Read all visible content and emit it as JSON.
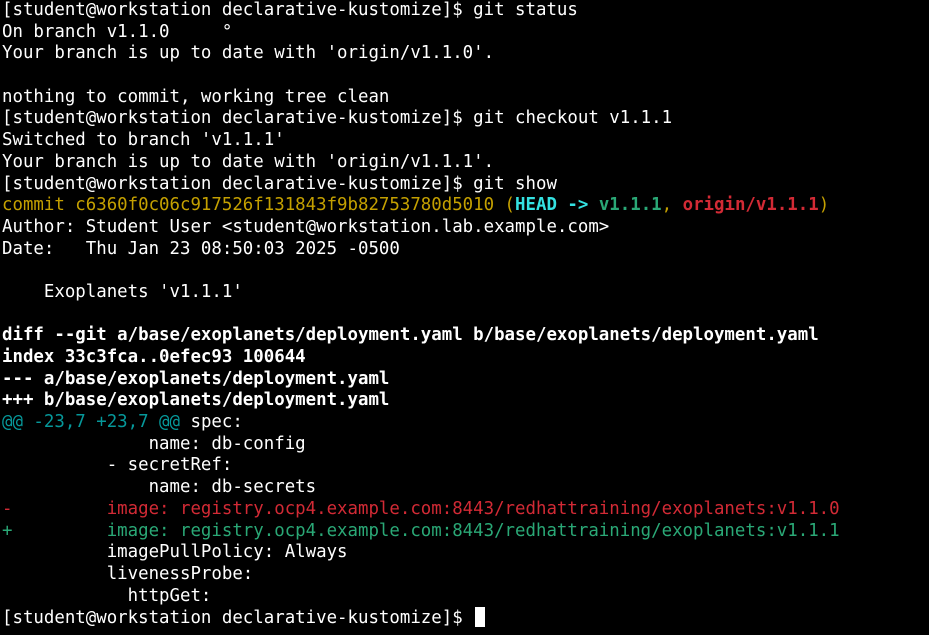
{
  "window": {
    "type": "terminal",
    "background": "#000000",
    "foreground": "#ffffff"
  },
  "lines": [
    {
      "segs": [
        {
          "t": "[student@workstation declarative-kustomize]$ git status",
          "c": "default"
        }
      ]
    },
    {
      "segs": [
        {
          "t": "On branch v1.1.0     °",
          "c": "default"
        }
      ]
    },
    {
      "segs": [
        {
          "t": "Your branch is up to date with 'origin/v1.1.0'.",
          "c": "default"
        }
      ]
    },
    {
      "segs": [
        {
          "t": "",
          "c": "default"
        }
      ]
    },
    {
      "segs": [
        {
          "t": "nothing to commit, working tree clean",
          "c": "default"
        }
      ]
    },
    {
      "segs": [
        {
          "t": "[student@workstation declarative-kustomize]$ git checkout v1.1.1",
          "c": "default"
        }
      ]
    },
    {
      "segs": [
        {
          "t": "Switched to branch 'v1.1.1'",
          "c": "default"
        }
      ]
    },
    {
      "segs": [
        {
          "t": "Your branch is up to date with 'origin/v1.1.1'.",
          "c": "default"
        }
      ]
    },
    {
      "segs": [
        {
          "t": "[student@workstation declarative-kustomize]$ git show",
          "c": "default"
        }
      ]
    },
    {
      "segs": [
        {
          "t": "commit c6360f0c06c917526f131843f9b82753780d5010 (",
          "c": "yellow"
        },
        {
          "t": "HEAD -> ",
          "c": "bcyan",
          "b": true
        },
        {
          "t": "v1.1.1",
          "c": "green",
          "b": true
        },
        {
          "t": ", ",
          "c": "yellow"
        },
        {
          "t": "origin/v1.1.1",
          "c": "red",
          "b": true
        },
        {
          "t": ")",
          "c": "yellow"
        }
      ]
    },
    {
      "segs": [
        {
          "t": "Author: Student User <student@workstation.lab.example.com>",
          "c": "default"
        }
      ]
    },
    {
      "segs": [
        {
          "t": "Date:   Thu Jan 23 08:50:03 2025 -0500",
          "c": "default"
        }
      ]
    },
    {
      "segs": [
        {
          "t": "",
          "c": "default"
        }
      ]
    },
    {
      "segs": [
        {
          "t": "    Exoplanets 'v1.1.1'",
          "c": "default"
        }
      ]
    },
    {
      "segs": [
        {
          "t": "",
          "c": "default"
        }
      ]
    },
    {
      "segs": [
        {
          "t": "diff --git a/base/exoplanets/deployment.yaml b/base/exoplanets/deployment.yaml",
          "c": "default",
          "b": true
        }
      ]
    },
    {
      "segs": [
        {
          "t": "index 33c3fca..0efec93 100644",
          "c": "default",
          "b": true
        }
      ]
    },
    {
      "segs": [
        {
          "t": "--- a/base/exoplanets/deployment.yaml",
          "c": "default",
          "b": true
        }
      ]
    },
    {
      "segs": [
        {
          "t": "+++ b/base/exoplanets/deployment.yaml",
          "c": "default",
          "b": true
        }
      ]
    },
    {
      "segs": [
        {
          "t": "@@ -23,7 +23,7 @@",
          "c": "meta"
        },
        {
          "t": " spec:",
          "c": "default"
        }
      ]
    },
    {
      "segs": [
        {
          "t": "              name: db-config",
          "c": "default"
        }
      ]
    },
    {
      "segs": [
        {
          "t": "          - secretRef:",
          "c": "default"
        }
      ]
    },
    {
      "segs": [
        {
          "t": "              name: db-secrets",
          "c": "default"
        }
      ]
    },
    {
      "segs": [
        {
          "t": "-         image: registry.ocp4.example.com:8443/redhattraining/exoplanets:v1.1.0",
          "c": "red"
        }
      ]
    },
    {
      "segs": [
        {
          "t": "+         image: registry.ocp4.example.com:8443/redhattraining/exoplanets:v1.1.1",
          "c": "green"
        }
      ]
    },
    {
      "segs": [
        {
          "t": "          imagePullPolicy: Always",
          "c": "default"
        }
      ]
    },
    {
      "segs": [
        {
          "t": "          livenessProbe:",
          "c": "default"
        }
      ]
    },
    {
      "segs": [
        {
          "t": "            httpGet:",
          "c": "default"
        }
      ]
    },
    {
      "segs": [
        {
          "t": "[student@workstation declarative-kustomize]$ ",
          "c": "default"
        }
      ],
      "cursor": true
    }
  ],
  "colors": {
    "default": "#ffffff",
    "yellow": "#c4a000",
    "bcyan": "#34e2e2",
    "green": "#2aa876",
    "red": "#d22a35",
    "meta": "#06989a"
  }
}
